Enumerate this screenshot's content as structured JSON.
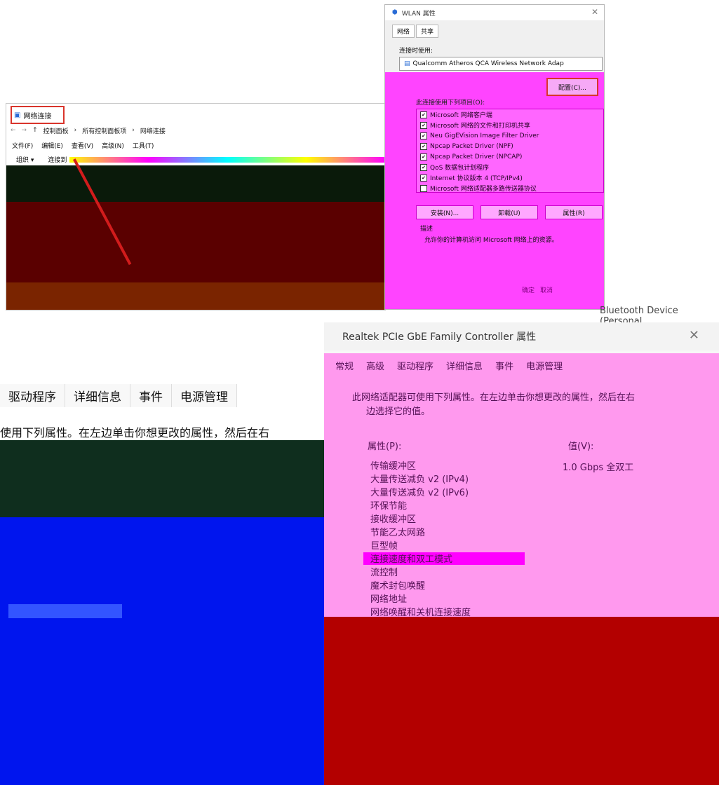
{
  "network_window": {
    "title": "网络连接",
    "breadcrumb": [
      "控制面板",
      "所有控制面板项",
      "网络连接"
    ],
    "menu": [
      "文件(F)",
      "编辑(E)",
      "查看(V)",
      "高级(N)",
      "工具(T)"
    ],
    "toolbar": [
      "组织 ▾",
      "连接到"
    ]
  },
  "wlan_dialog": {
    "title": "WLAN 属性",
    "tabs": [
      "网络",
      "共享"
    ],
    "connect_using_label": "连接时使用:",
    "adapter": "Qualcomm Atheros QCA Wireless Network Adap",
    "configure_button": "配置(C)...",
    "items_label": "此连接使用下列项目(O):",
    "items": [
      {
        "label": "Microsoft 网络客户端",
        "checked": true
      },
      {
        "label": "Microsoft 网络的文件和打印机共享",
        "checked": true
      },
      {
        "label": "Neu GigEVision Image Filter Driver",
        "checked": true
      },
      {
        "label": "Npcap Packet Driver (NPF)",
        "checked": true
      },
      {
        "label": "Npcap Packet Driver (NPCAP)",
        "checked": true
      },
      {
        "label": "QoS 数据包计划程序",
        "checked": true
      },
      {
        "label": "Internet 协议版本 4 (TCP/IPv4)",
        "checked": true
      },
      {
        "label": "Microsoft 网络适配器多路传送器协议",
        "checked": false
      }
    ],
    "buttons": [
      "安装(N)...",
      "卸载(U)",
      "属性(R)"
    ],
    "description_label": "描述",
    "description": "允许你的计算机访问 Microsoft 网络上的资源。",
    "footer": [
      "确定",
      "取消"
    ]
  },
  "bluetooth_text": "Bluetooth Device (Personal",
  "left_fragment": {
    "tabs": [
      "驱动程序",
      "详细信息",
      "事件",
      "电源管理"
    ],
    "text": "使用下列属性。在左边单击你想更改的属性，然后在右"
  },
  "realtek_dialog": {
    "title": "Realtek PCIe GbE Family Controller 属性",
    "tabs": [
      "常规",
      "高级",
      "驱动程序",
      "详细信息",
      "事件",
      "电源管理"
    ],
    "intro_1": "此网络适配器可使用下列属性。在左边单击你想更改的属性，然后在右",
    "intro_2": "边选择它的值。",
    "property_label": "属性(P):",
    "value_label": "值(V):",
    "properties": [
      "传输缓冲区",
      "大量传送减负 v2 (IPv4)",
      "大量传送减负 v2 (IPv6)",
      "环保节能",
      "接收缓冲区",
      "节能乙太网路",
      "巨型帧",
      "连接速度和双工模式",
      "流控制",
      "魔术封包唤醒",
      "网络地址",
      "网络唤醒和关机连接速度"
    ],
    "value": "1.0 Gbps 全双工"
  }
}
